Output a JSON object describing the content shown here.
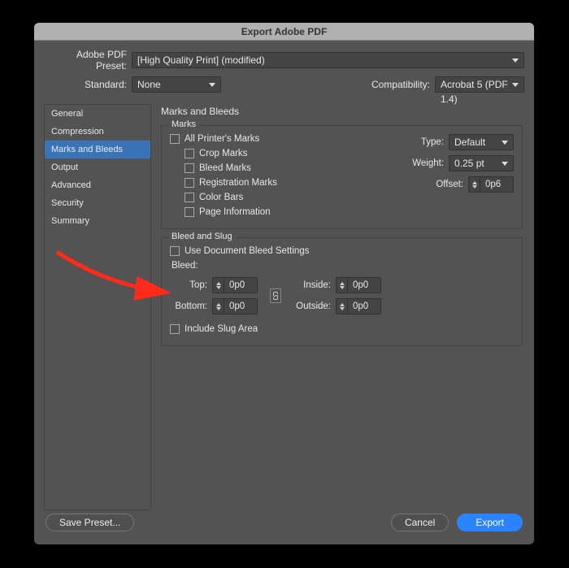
{
  "title": "Export Adobe PDF",
  "preset": {
    "label": "Adobe PDF Preset:",
    "value": "[High Quality Print] (modified)"
  },
  "standard": {
    "label": "Standard:",
    "value": "None"
  },
  "compat": {
    "label": "Compatibility:",
    "value": "Acrobat 5 (PDF 1.4)"
  },
  "sidebar": {
    "items": [
      {
        "label": "General"
      },
      {
        "label": "Compression"
      },
      {
        "label": "Marks and Bleeds"
      },
      {
        "label": "Output"
      },
      {
        "label": "Advanced"
      },
      {
        "label": "Security"
      },
      {
        "label": "Summary"
      }
    ]
  },
  "panel": {
    "title": "Marks and Bleeds"
  },
  "marks": {
    "legend": "Marks",
    "all": "All Printer's Marks",
    "crop": "Crop Marks",
    "bleed": "Bleed Marks",
    "reg": "Registration Marks",
    "color": "Color Bars",
    "page": "Page Information",
    "type_label": "Type:",
    "type_value": "Default",
    "weight_label": "Weight:",
    "weight_value": "0.25 pt",
    "offset_label": "Offset:",
    "offset_value": "0p6"
  },
  "bleedSlug": {
    "legend": "Bleed and Slug",
    "use_doc": "Use Document Bleed Settings",
    "bleed_label": "Bleed:",
    "top_label": "Top:",
    "top_value": "0p0",
    "bottom_label": "Bottom:",
    "bottom_value": "0p0",
    "inside_label": "Inside:",
    "inside_value": "0p0",
    "outside_label": "Outside:",
    "outside_value": "0p0",
    "include_slug": "Include Slug Area"
  },
  "footer": {
    "save_preset": "Save Preset...",
    "cancel": "Cancel",
    "export": "Export"
  }
}
